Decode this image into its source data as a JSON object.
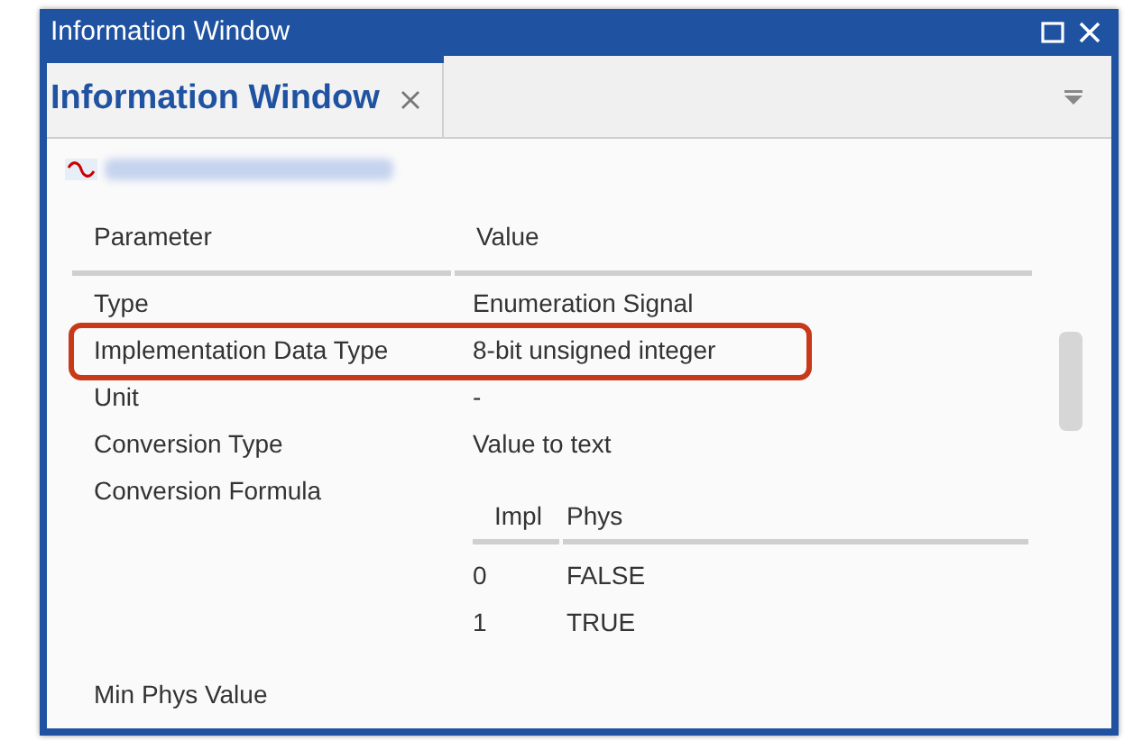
{
  "window": {
    "title": "Information Window"
  },
  "tabs": [
    {
      "label": "Information Window",
      "selected": true
    }
  ],
  "table": {
    "columns": [
      "Parameter",
      "Value"
    ],
    "rows": [
      {
        "parameter": "Type",
        "value": "Enumeration Signal",
        "highlighted": false
      },
      {
        "parameter": "Implementation Data Type",
        "value": "8-bit unsigned integer",
        "highlighted": true
      },
      {
        "parameter": "Unit",
        "value": "-",
        "highlighted": false
      },
      {
        "parameter": "Conversion Type",
        "value": "Value to text",
        "highlighted": false
      },
      {
        "parameter": "Conversion Formula",
        "kind": "formula",
        "highlighted": false,
        "formula": {
          "columns": [
            "Impl",
            "Phys"
          ],
          "rows": [
            [
              "0",
              "FALSE"
            ],
            [
              "1",
              "TRUE"
            ]
          ]
        }
      },
      {
        "parameter": "Min Phys Value",
        "value": "",
        "highlighted": false
      }
    ]
  }
}
